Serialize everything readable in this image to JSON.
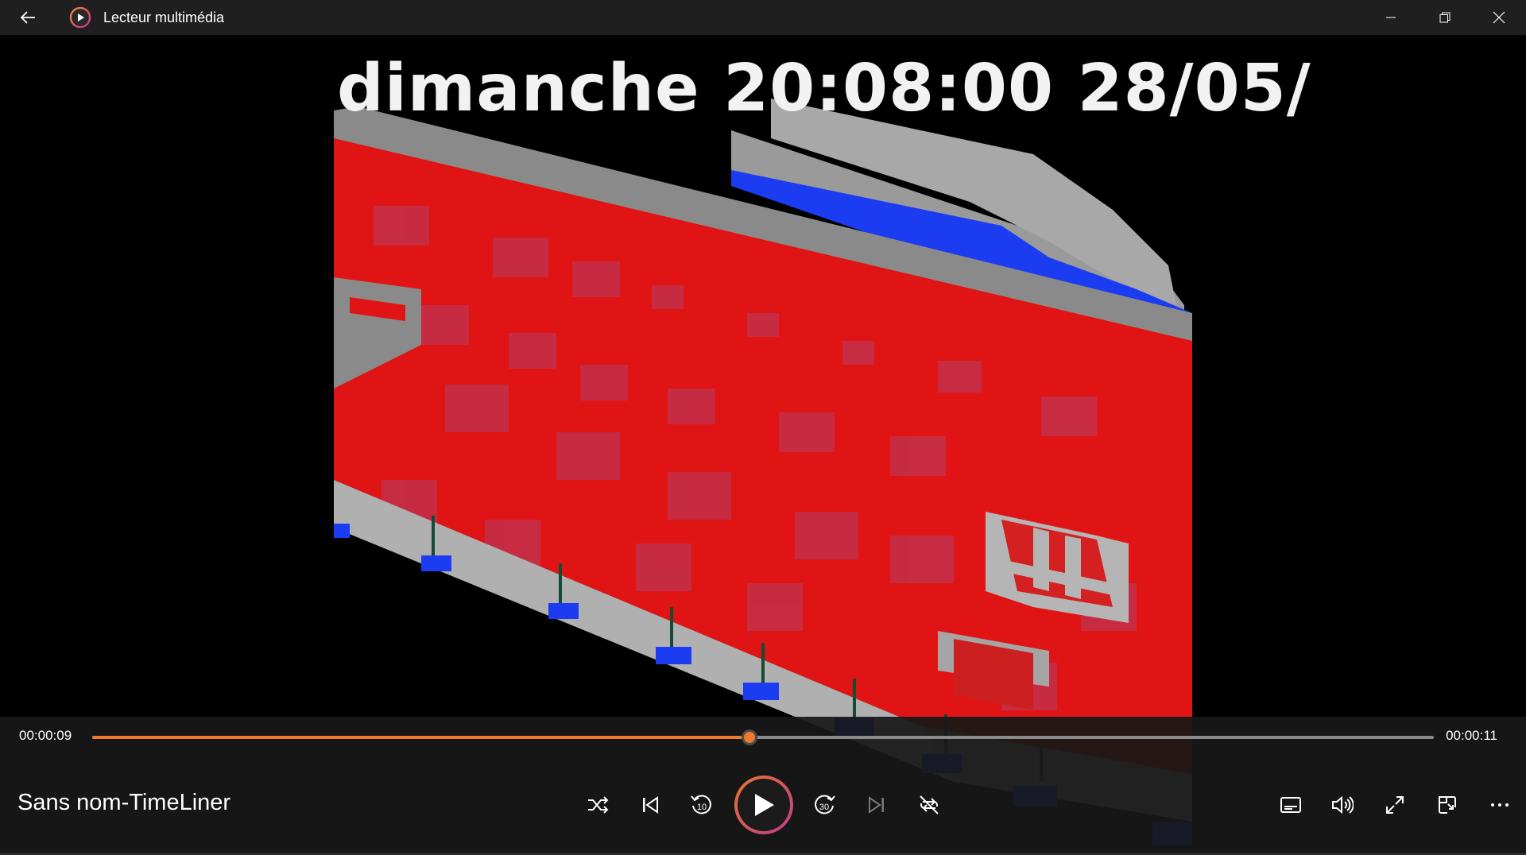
{
  "window": {
    "title": "Lecteur multimédia",
    "controls": [
      "minimize-icon",
      "restore-icon",
      "close-icon"
    ]
  },
  "video": {
    "overlay_text": "dimanche 20:08:00 28/05/"
  },
  "player": {
    "current_time": "00:00:09",
    "total_time": "00:00:11",
    "progress": 0.49,
    "media_title": "Sans nom-TimeLiner",
    "accent_color": "#ee7a2e",
    "skip_back_label": "10",
    "skip_forward_label": "30",
    "buttons": [
      "shuffle-icon",
      "previous-icon",
      "skip-back-10-icon",
      "play-icon",
      "skip-forward-30-icon",
      "next-icon",
      "repeat-off-icon",
      "subtitles-icon",
      "volume-icon",
      "fullscreen-icon",
      "mini-player-icon",
      "more-icon"
    ]
  }
}
